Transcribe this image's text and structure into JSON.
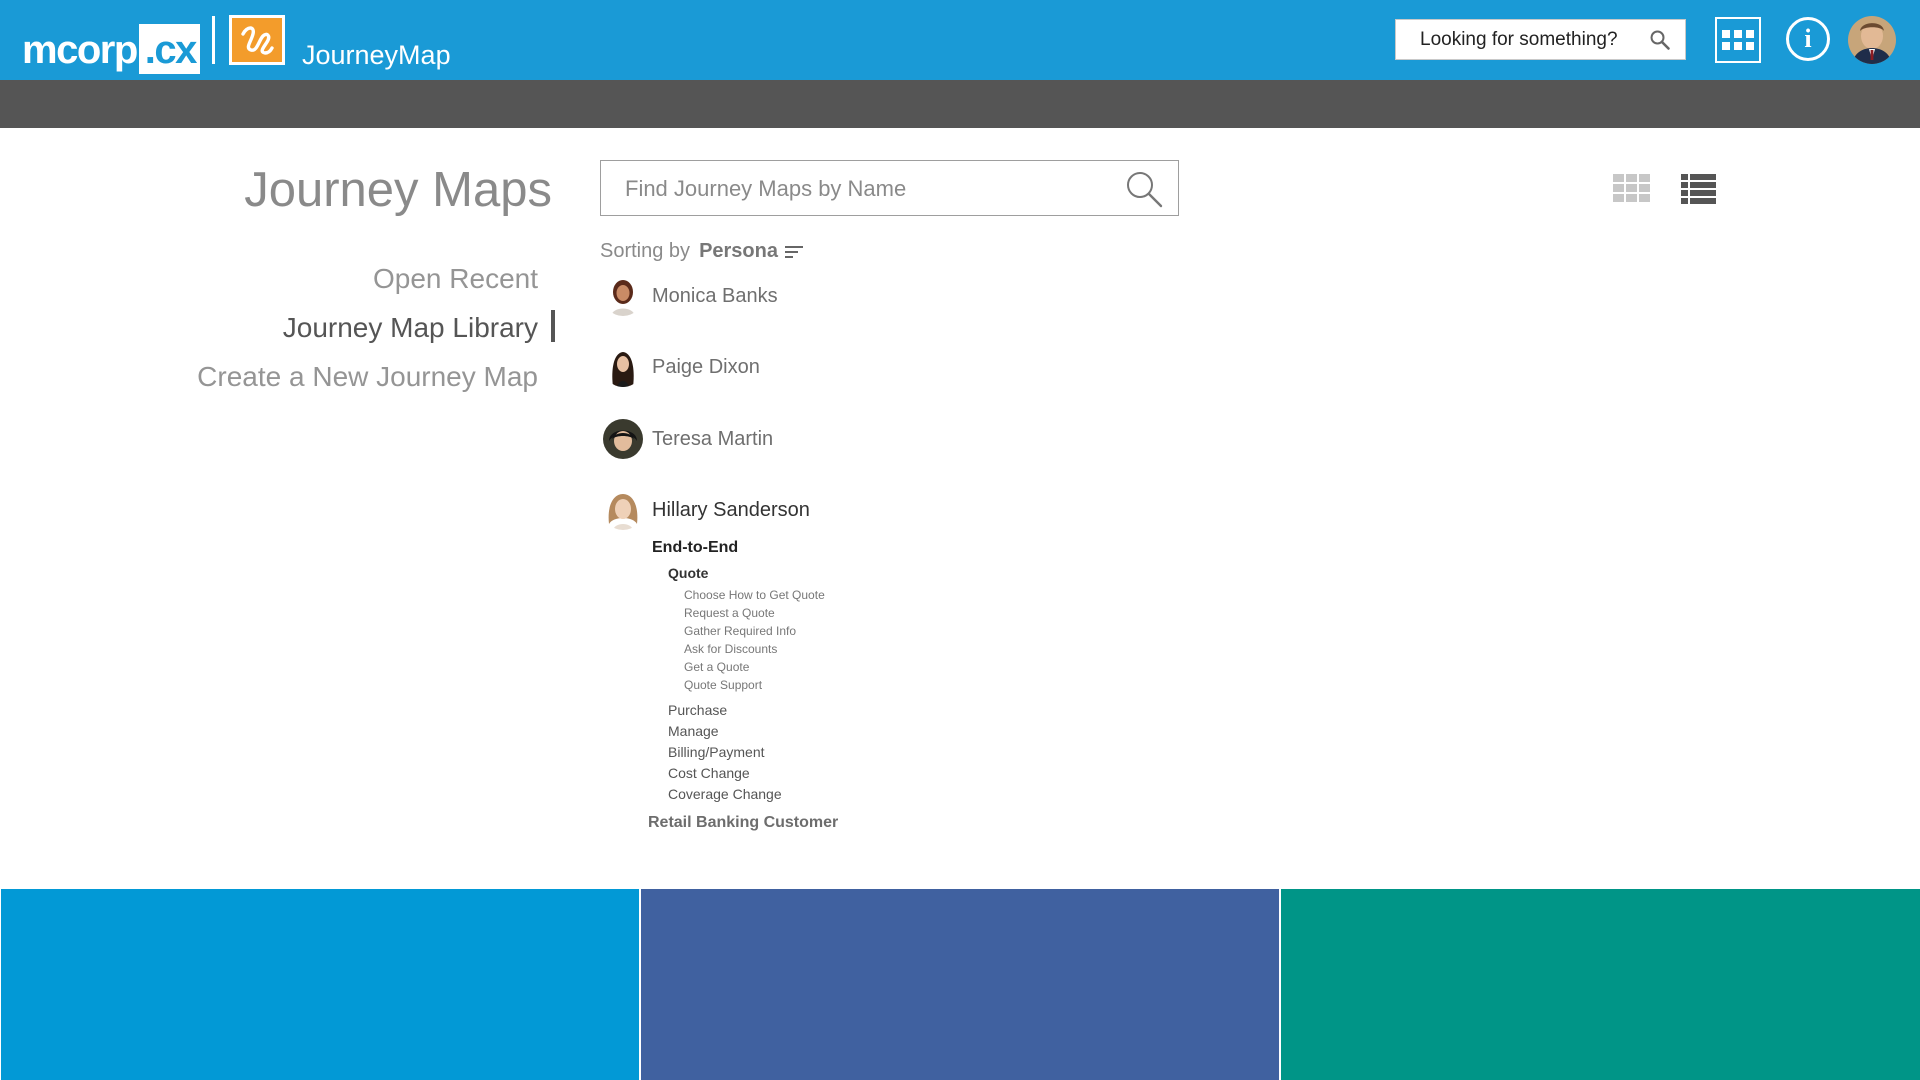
{
  "header": {
    "logo_part1": "mcorp",
    "logo_part2": ".cx",
    "app_name": "JourneyMap",
    "search_placeholder": "Looking for something?"
  },
  "colors": {
    "header_blue": "#1a9ad6",
    "subbar_gray": "#555555",
    "app_icon_orange": "#f39c2b",
    "tile_1": "#0299d6",
    "tile_2": "#4061a0",
    "tile_3": "#009587"
  },
  "icons": {
    "global_search": "search-icon",
    "apps": "apps-grid-icon",
    "info": "info-icon",
    "map_search": "magnifier-icon",
    "grid_view": "grid-view-icon",
    "list_view": "list-view-icon",
    "sort": "sort-lines-icon"
  },
  "page": {
    "title": "Journey Maps",
    "nav": [
      {
        "label": "Open Recent"
      },
      {
        "label": "Journey Map Library"
      },
      {
        "label": "Create a New Journey Map"
      }
    ],
    "search_placeholder": "Find Journey Maps by Name"
  },
  "sorting": {
    "label": "Sorting by",
    "value": "Persona"
  },
  "personas": [
    {
      "name": "Monica Banks"
    },
    {
      "name": "Paige Dixon"
    },
    {
      "name": "Teresa Martin"
    },
    {
      "name": "Hillary Sanderson"
    }
  ],
  "tree": {
    "journey": "End-to-End",
    "stage_open": "Quote",
    "steps": [
      "Choose How to Get Quote",
      "Request a Quote",
      "Gather Required Info",
      "Ask for Discounts",
      "Get a Quote",
      "Quote Support"
    ],
    "stages": [
      "Purchase",
      "Manage",
      "Billing/Payment",
      "Cost Change",
      "Coverage Change"
    ],
    "next_journey": "Retail Banking Customer"
  }
}
